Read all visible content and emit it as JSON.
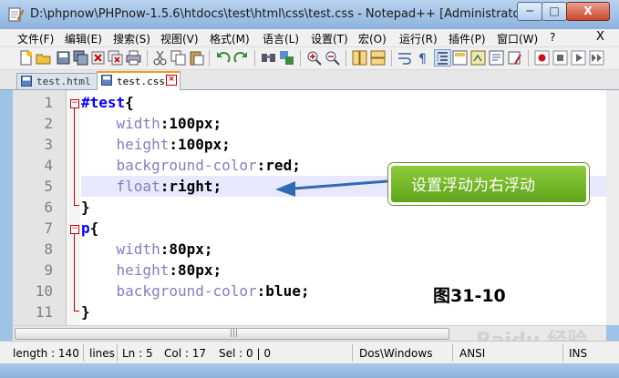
{
  "window": {
    "title": "D:\\phpnow\\PHPnow-1.5.6\\htdocs\\test\\html\\css\\test.css - Notepad++ [Administrator]",
    "controls": {
      "minimize": "─",
      "maximize": "□",
      "close": "X"
    }
  },
  "menu": {
    "items": [
      "文件(F)",
      "编辑(E)",
      "搜索(S)",
      "视图(V)",
      "格式(M)",
      "语言(L)",
      "设置(T)",
      "宏(O)",
      "运行(R)",
      "插件(P)",
      "窗口(W)",
      "?"
    ],
    "close": "X"
  },
  "tabs": [
    {
      "label": "test.html",
      "active": false
    },
    {
      "label": "test.css",
      "active": true
    }
  ],
  "editor": {
    "line_numbers": [
      "1",
      "2",
      "3",
      "4",
      "5",
      "6",
      "7",
      "8",
      "9",
      "10",
      "11"
    ],
    "current_line": 5,
    "lines": [
      {
        "selector": "#test",
        "brace": "{"
      },
      {
        "indent": "    ",
        "prop": "width",
        "colon": ":",
        "value": "100px",
        "semi": ";"
      },
      {
        "indent": "    ",
        "prop": "height",
        "colon": ":",
        "value": "100px",
        "semi": ";"
      },
      {
        "indent": "    ",
        "prop": "background-color",
        "colon": ":",
        "value": "red",
        "semi": ";"
      },
      {
        "indent": "    ",
        "prop": "float",
        "colon": ":",
        "value": "right",
        "semi": ";"
      },
      {
        "brace": "}"
      },
      {
        "selector": "p",
        "brace": "{"
      },
      {
        "indent": "    ",
        "prop": "width",
        "colon": ":",
        "value": "80px",
        "semi": ";"
      },
      {
        "indent": "    ",
        "prop": "height",
        "colon": ":",
        "value": "80px",
        "semi": ";"
      },
      {
        "indent": "    ",
        "prop": "background-color",
        "colon": ":",
        "value": "blue",
        "semi": ";"
      },
      {
        "brace": "}"
      }
    ]
  },
  "annotation": {
    "callout_text": "设置浮动为右浮动",
    "figure_label": "图31-10",
    "watermark": "Baidu 经验"
  },
  "statusbar": {
    "length": "length : 140",
    "lines": "lines",
    "ln": "Ln : 5",
    "col": "Col : 17",
    "sel": "Sel : 0 | 0",
    "eol": "Dos\\Windows",
    "encoding": "ANSI",
    "mode": "INS"
  },
  "colors": {
    "selector": "#0000ff",
    "property": "#8080c0",
    "fold": "#c00000",
    "callout_bg": "#72b52a",
    "arrow": "#2f6bb5",
    "active_tab_accent": "#f39c1b"
  }
}
